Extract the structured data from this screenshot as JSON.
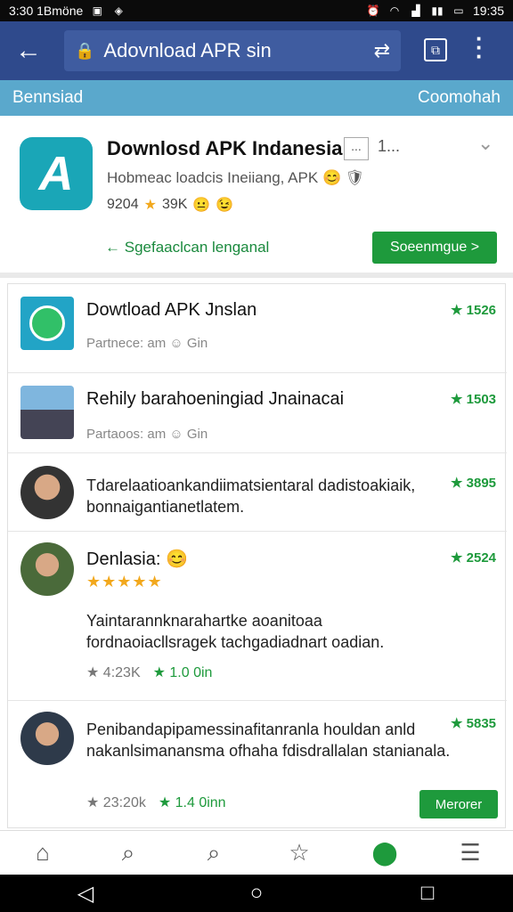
{
  "statusbar": {
    "left_text": "3:30 1Bmöne",
    "time": "19:35"
  },
  "topbar": {
    "url": "Adovnload APR sin"
  },
  "subbar": {
    "left": "Bennsiad",
    "right": "Coomohah"
  },
  "hero": {
    "title": "Downlosd APK Indanesia",
    "dots": "...",
    "extra": "1...",
    "subtitle": "Hobmeac loadcis Ineiiang, APK",
    "meta_count": "9204",
    "meta_rating": "39K",
    "link_text": "Sgefaaclcan lenganal",
    "button": "Soeenmgue >"
  },
  "list": {
    "items": [
      {
        "title": "Dowtload APK Jnslan",
        "sub": "Partnece: am",
        "sub2": "Gin",
        "rating": "★ 1526"
      },
      {
        "title": "Rehily barahoeningiad Jnainacai",
        "sub": "Partaoos: am",
        "sub2": "Gin",
        "rating": "★ 1503"
      },
      {
        "text": "Tdarelaatioankandiimatsientaral dadistoakiaik, bonnaigantianetlatem.",
        "rating": "★ 3895"
      },
      {
        "title": "Denlasia:",
        "stars": "★★★★★",
        "text": "Yaintarannknarahartke aoanitoaa fordnaoiacllsragek tachgadiadnart oadian.",
        "stat1": "4:23K",
        "stat2": "1.0 0in",
        "rating": "★ 2524"
      },
      {
        "text": "Penibandapipamessinafitanranla houldan anld nakanlsimanansma ofhaha fdisdrallalan stanianala.",
        "stat1": "23:20k",
        "stat2": "1.4 0inn",
        "rating": "★ 5835",
        "button": "Merorer"
      }
    ]
  },
  "colors": {
    "topbar": "#2f4a8c",
    "subbar": "#5aa8cc",
    "accent_green": "#1e9a3c",
    "app_icon": "#1aa6b7",
    "star": "#f2a81d"
  },
  "icons": {
    "back": "arrow-left-icon",
    "lock": "lock-icon",
    "share": "share-icon",
    "tabs": "tabs-icon",
    "menu": "more-vert-icon",
    "nav": [
      "home-icon",
      "search-icon",
      "search-icon",
      "star-icon",
      "download-icon",
      "menu-icon"
    ]
  }
}
